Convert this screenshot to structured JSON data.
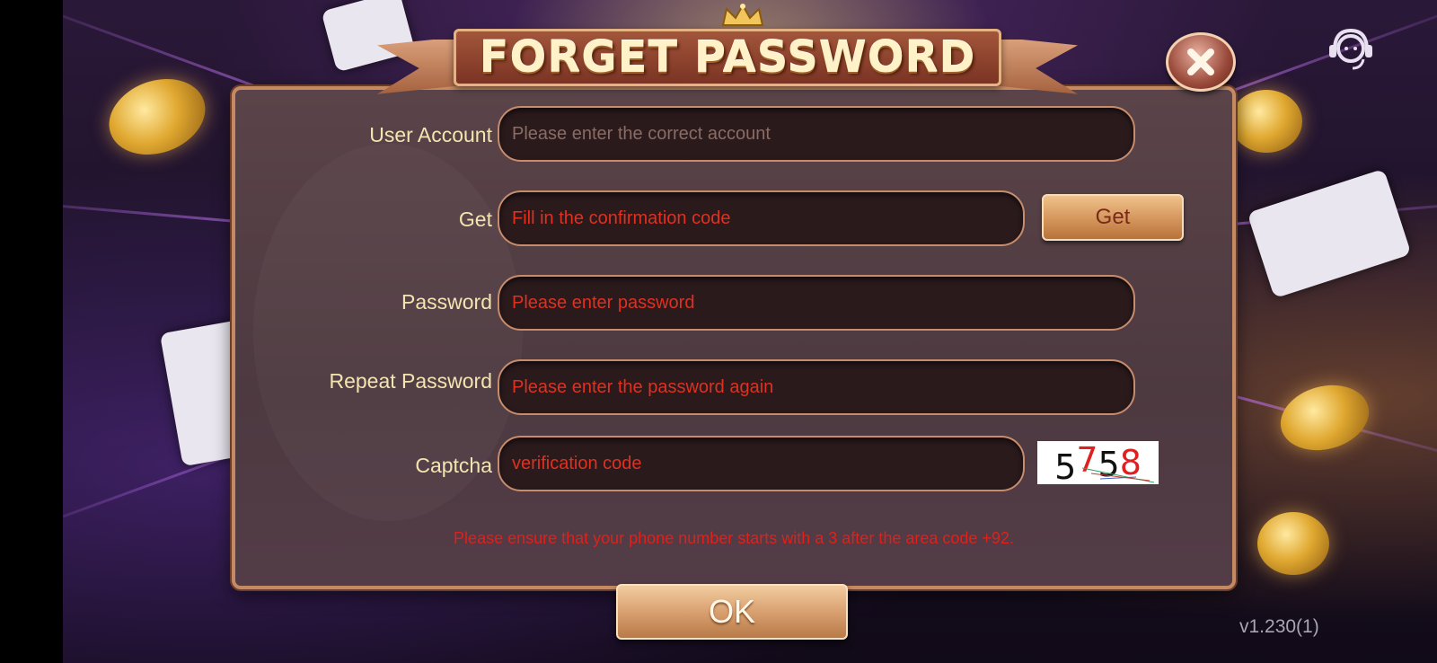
{
  "dialog": {
    "title": "FORGET PASSWORD"
  },
  "form": {
    "account": {
      "label": "User Account",
      "placeholder": "Please enter the correct account"
    },
    "code": {
      "label": "Get",
      "placeholder": "Fill in the confirmation code",
      "button_label": "Get"
    },
    "password": {
      "label": "Password",
      "placeholder": "Please enter password"
    },
    "repeat_password": {
      "label": "Repeat Password",
      "placeholder": "Please enter the password again"
    },
    "captcha": {
      "label": "Captcha",
      "placeholder": "verification code",
      "digits": [
        "5",
        "7",
        "5",
        "8"
      ],
      "digit_colors": [
        "#111111",
        "#e02020",
        "#111111",
        "#e02020"
      ]
    }
  },
  "notice": "Please ensure that your phone number starts with a 3 after the area code +92.",
  "ok_label": "OK",
  "version": "v1.230(1)",
  "icons": {
    "close": "close-icon",
    "support": "customer-service-icon",
    "crown": "crown-icon"
  },
  "colors": {
    "accent_gold": "#d9a070",
    "field_bg": "#2a1a1c",
    "label_text": "#f3e4b0",
    "warning_red": "#e0201a"
  }
}
